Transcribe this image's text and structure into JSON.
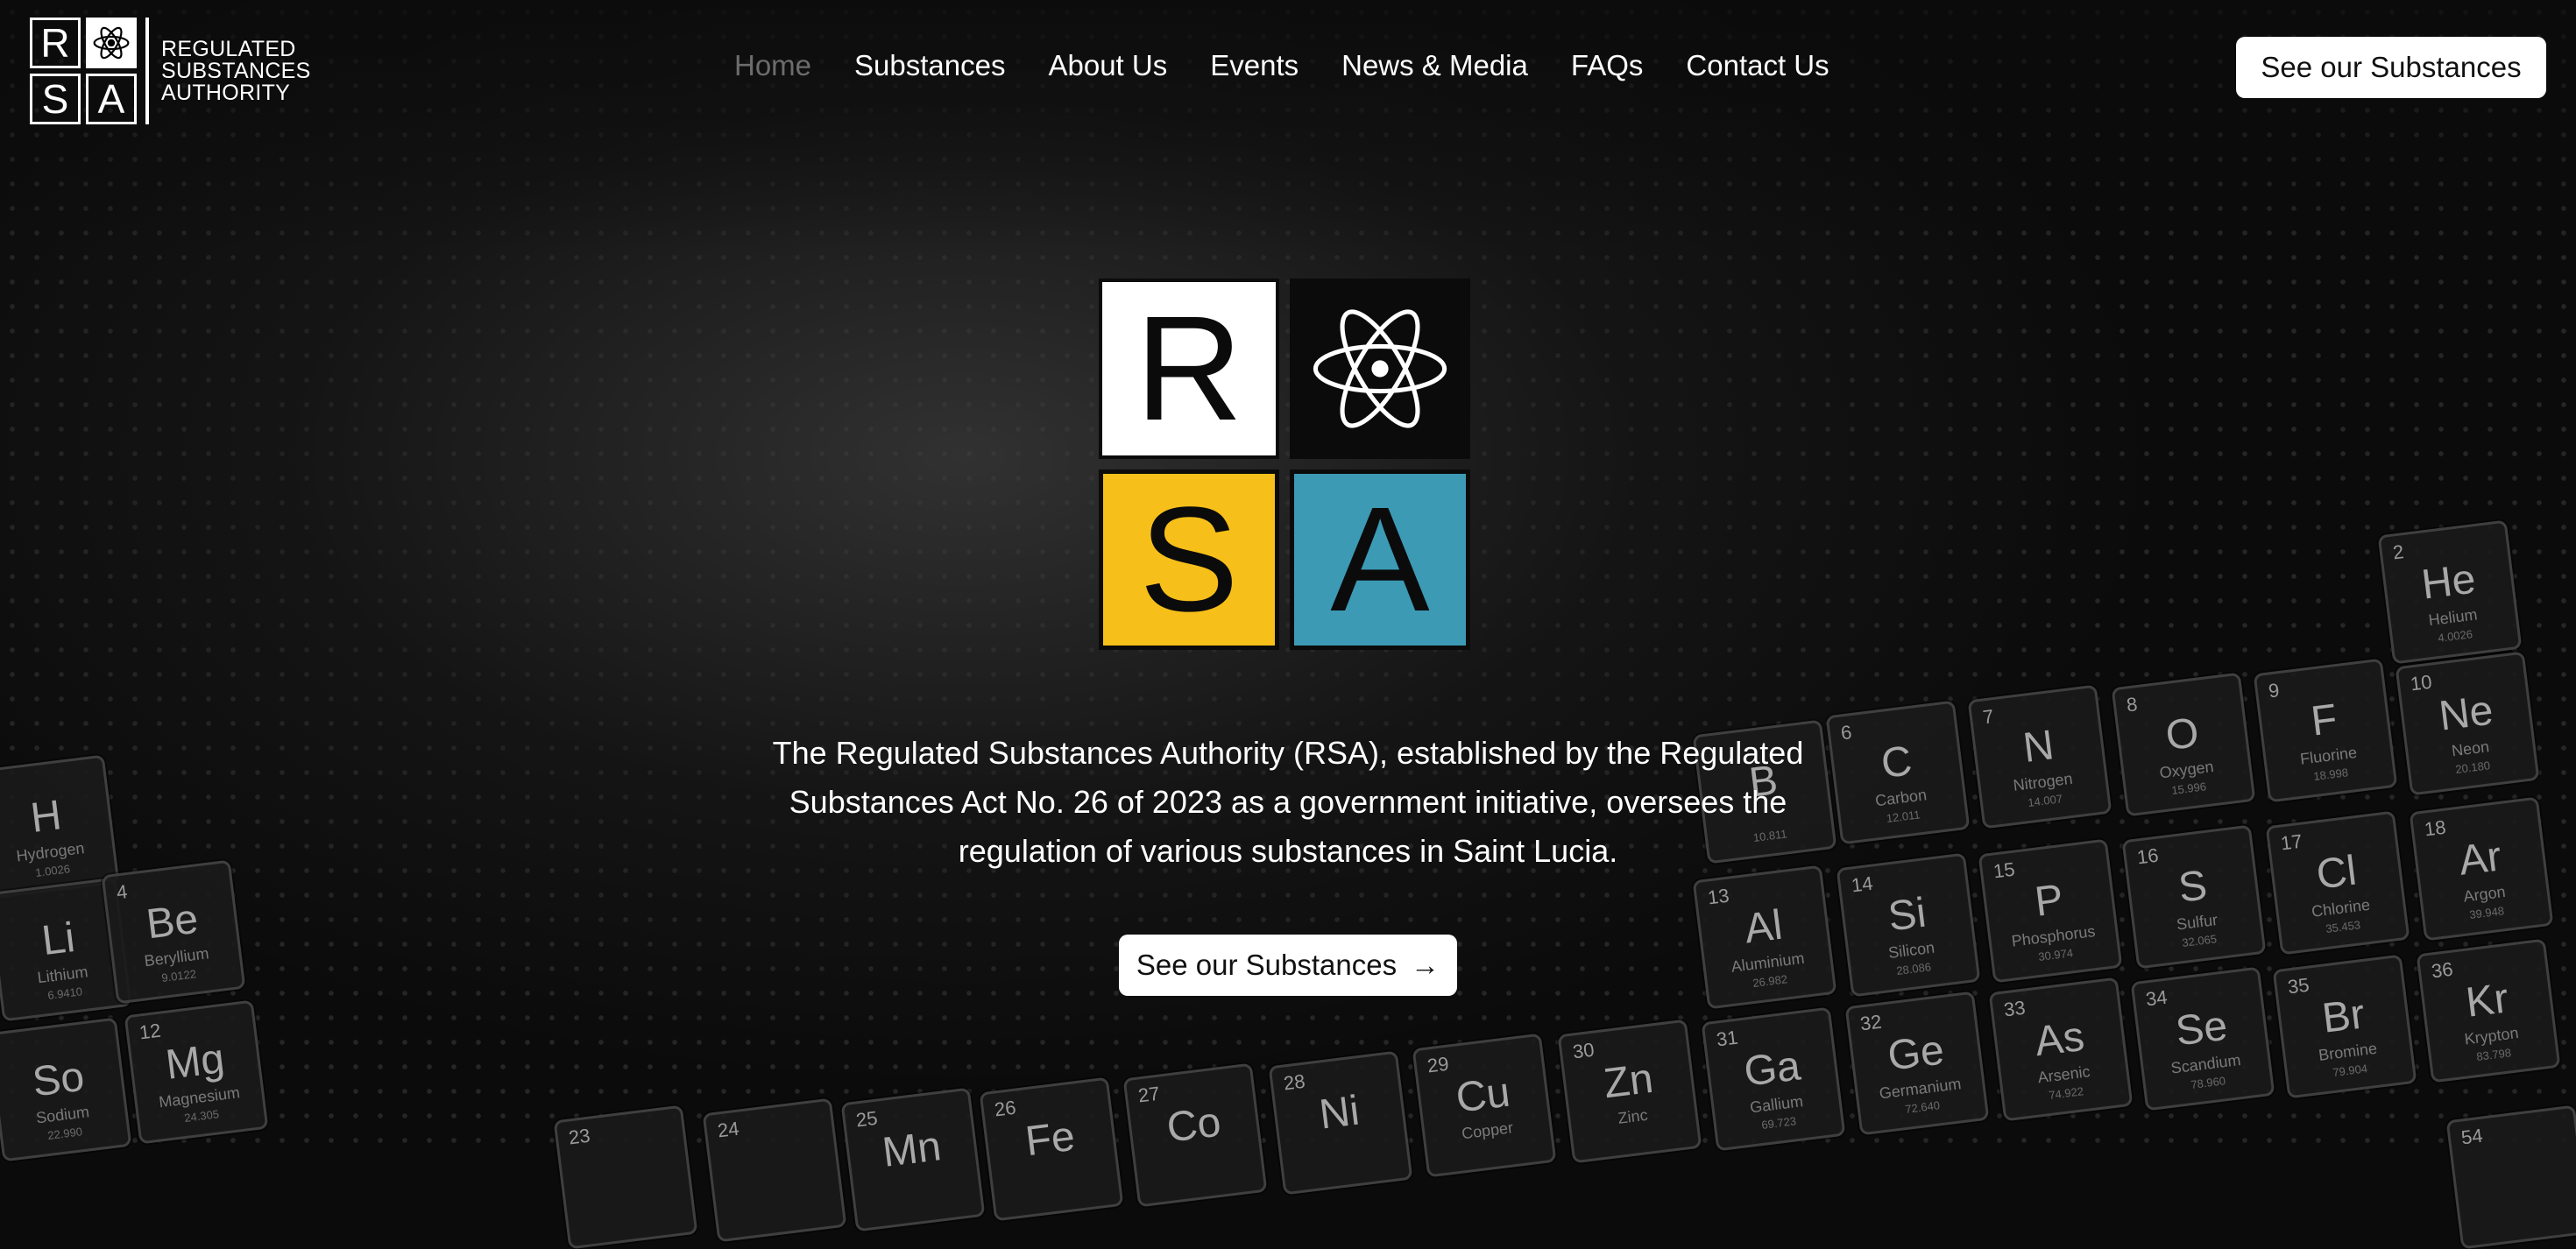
{
  "logo": {
    "letters": [
      "R",
      "S",
      "A"
    ],
    "text_lines": [
      "REGULATED",
      "SUBSTANCES",
      "AUTHORITY"
    ]
  },
  "nav": {
    "items": [
      "Home",
      "Substances",
      "About Us",
      "Events",
      "News & Media",
      "FAQs",
      "Contact Us"
    ]
  },
  "header_button": "See our Substances",
  "hero": {
    "tiles": [
      "R",
      "S",
      "A"
    ],
    "description": "The Regulated Substances Authority (RSA), established by the Regulated Substances Act No. 26 of 2023 as a government initiative, oversees the regulation of various substances in Saint Lucia.",
    "button_label": "See our Substances",
    "button_icon": "arrow-right-icon"
  },
  "colors": {
    "tile_yellow": "#f7bf19",
    "tile_blue": "#3c9ab5",
    "background": "#0b0b0b"
  },
  "elements": [
    {
      "num": "",
      "sym": "H",
      "name": "Hydrogen",
      "wt": "1.0026"
    },
    {
      "num": "",
      "sym": "Li",
      "name": "Lithium",
      "wt": "6.9410"
    },
    {
      "num": "4",
      "sym": "Be",
      "name": "Beryllium",
      "wt": "9.0122"
    },
    {
      "num": "",
      "sym": "So",
      "name": "Sodium",
      "wt": "22.990"
    },
    {
      "num": "12",
      "sym": "Mg",
      "name": "Magnesium",
      "wt": "24.305"
    },
    {
      "num": "2",
      "sym": "He",
      "name": "Helium",
      "wt": "4.0026"
    },
    {
      "num": "",
      "sym": "B",
      "name": "",
      "wt": "10.811"
    },
    {
      "num": "6",
      "sym": "C",
      "name": "Carbon",
      "wt": "12.011"
    },
    {
      "num": "7",
      "sym": "N",
      "name": "Nitrogen",
      "wt": "14.007"
    },
    {
      "num": "8",
      "sym": "O",
      "name": "Oxygen",
      "wt": "15.996"
    },
    {
      "num": "9",
      "sym": "F",
      "name": "Fluorine",
      "wt": "18.998"
    },
    {
      "num": "10",
      "sym": "Ne",
      "name": "Neon",
      "wt": "20.180"
    },
    {
      "num": "13",
      "sym": "Al",
      "name": "Aluminium",
      "wt": "26.982"
    },
    {
      "num": "14",
      "sym": "Si",
      "name": "Silicon",
      "wt": "28.086"
    },
    {
      "num": "15",
      "sym": "P",
      "name": "Phosphorus",
      "wt": "30.974"
    },
    {
      "num": "16",
      "sym": "S",
      "name": "Sulfur",
      "wt": "32.065"
    },
    {
      "num": "17",
      "sym": "Cl",
      "name": "Chlorine",
      "wt": "35.453"
    },
    {
      "num": "18",
      "sym": "Ar",
      "name": "Argon",
      "wt": "39.948"
    },
    {
      "num": "24",
      "sym": "",
      "name": "",
      "wt": ""
    },
    {
      "num": "25",
      "sym": "Mn",
      "name": "",
      "wt": ""
    },
    {
      "num": "26",
      "sym": "Fe",
      "name": "",
      "wt": ""
    },
    {
      "num": "27",
      "sym": "Co",
      "name": "",
      "wt": ""
    },
    {
      "num": "28",
      "sym": "Ni",
      "name": "",
      "wt": ""
    },
    {
      "num": "29",
      "sym": "Cu",
      "name": "Copper",
      "wt": ""
    },
    {
      "num": "30",
      "sym": "Zn",
      "name": "Zinc",
      "wt": ""
    },
    {
      "num": "31",
      "sym": "Ga",
      "name": "Gallium",
      "wt": "69.723"
    },
    {
      "num": "32",
      "sym": "Ge",
      "name": "Germanium",
      "wt": "72.640"
    },
    {
      "num": "33",
      "sym": "As",
      "name": "Arsenic",
      "wt": "74.922"
    },
    {
      "num": "34",
      "sym": "Se",
      "name": "Scandium",
      "wt": "78.960"
    },
    {
      "num": "35",
      "sym": "Br",
      "name": "Bromine",
      "wt": "79.904"
    },
    {
      "num": "36",
      "sym": "Kr",
      "name": "Krypton",
      "wt": "83.798"
    },
    {
      "num": "54",
      "sym": "",
      "name": "",
      "wt": ""
    },
    {
      "num": "23",
      "sym": "",
      "name": "",
      "wt": ""
    }
  ]
}
